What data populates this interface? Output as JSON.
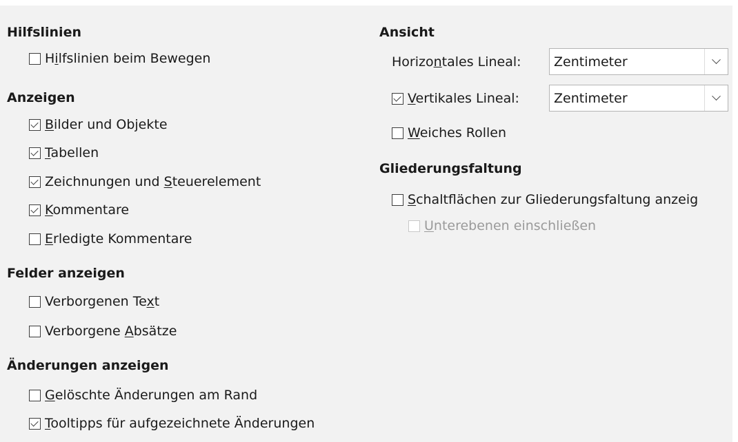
{
  "left": {
    "hilfslinien": {
      "title": "Hilfslinien",
      "items": [
        {
          "pre": "H",
          "u": "i",
          "post": "lfslinien beim Bewegen",
          "checked": false
        }
      ]
    },
    "anzeigen": {
      "title": "Anzeigen",
      "items": [
        {
          "pre": "",
          "u": "B",
          "post": "ilder und Objekte",
          "checked": true
        },
        {
          "pre": "",
          "u": "T",
          "post": "abellen",
          "checked": true
        },
        {
          "pre": "Zeichnungen und ",
          "u": "S",
          "post": "teuerelement",
          "checked": true
        },
        {
          "pre": "",
          "u": "K",
          "post": "ommentare",
          "checked": true
        },
        {
          "pre": "",
          "u": "E",
          "post": "rledigte Kommentare",
          "checked": false
        }
      ]
    },
    "felder": {
      "title": "Felder anzeigen",
      "items": [
        {
          "pre": "Verborgenen Te",
          "u": "x",
          "post": "t",
          "checked": false
        },
        {
          "pre": "Verborgene ",
          "u": "A",
          "post": "bsätze",
          "checked": false
        }
      ]
    },
    "aenderungen": {
      "title": "Änderungen anzeigen",
      "items": [
        {
          "pre": "",
          "u": "G",
          "post": "elöschte Änderungen am Rand",
          "checked": false
        },
        {
          "pre": "",
          "u": "T",
          "post": "ooltipps für aufgezeichnete Änderungen",
          "checked": true
        }
      ]
    }
  },
  "right": {
    "ansicht": {
      "title": "Ansicht",
      "horizontal_label_pre": "Horizo",
      "horizontal_label_u": "n",
      "horizontal_label_post": "tales Lineal:",
      "horizontal_value": "Zentimeter",
      "vertical_label_u": "V",
      "vertical_label_post": "ertikales Lineal:",
      "vertical_checked": true,
      "vertical_value": "Zentimeter",
      "weiches_u": "W",
      "weiches_post": "eiches Rollen",
      "weiches_checked": false
    },
    "gliederung": {
      "title": "Gliederungsfaltung",
      "buttons_u": "S",
      "buttons_post": "chaltflächen zur Gliederungsfaltung anzeig",
      "buttons_checked": false,
      "sub_u": "U",
      "sub_post": "nterebenen einschließen",
      "sub_checked": false
    }
  },
  "icons": {
    "combo": "chevron-down-icon",
    "checkbox": "checkbox"
  }
}
